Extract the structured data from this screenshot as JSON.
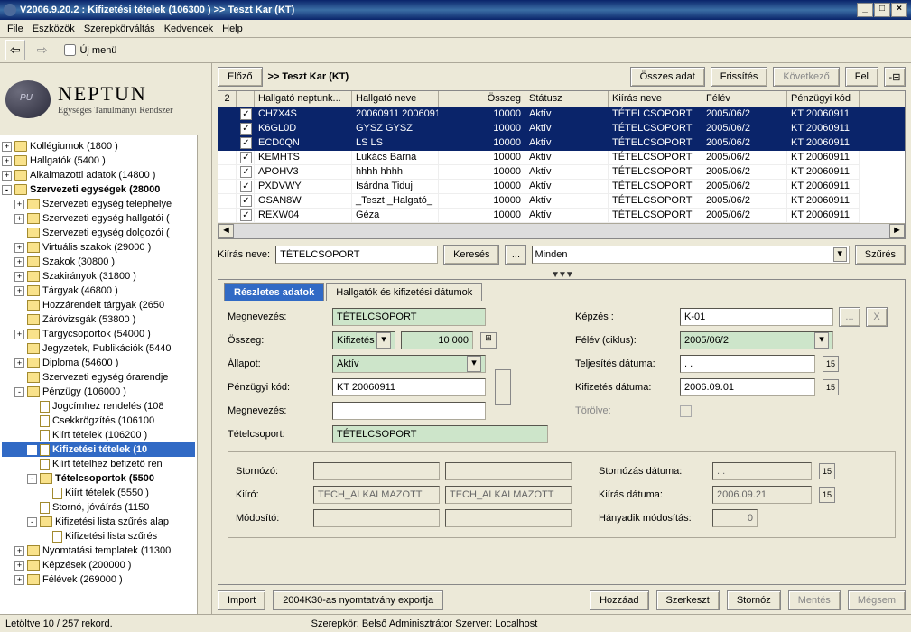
{
  "window": {
    "title": "V2006.9.20.2 : Kifizetési tételek (106300  )  >> Teszt Kar (KT)"
  },
  "menu": {
    "file": "File",
    "tools": "Eszközök",
    "roleswitch": "Szerepkörváltás",
    "fav": "Kedvencek",
    "help": "Help"
  },
  "toolbar": {
    "newmenu": "Új menü"
  },
  "brand": {
    "name": "NEPTUN",
    "sub": "Egységes Tanulmányi Rendszer"
  },
  "tree": [
    {
      "l": 0,
      "exp": "+",
      "ic": "folder-b",
      "t": "Kollégiumok (1800  )"
    },
    {
      "l": 0,
      "exp": "+",
      "ic": "folder-b",
      "t": "Hallgatók (5400  )"
    },
    {
      "l": 0,
      "exp": "+",
      "ic": "folder-b",
      "t": "Alkalmazotti adatok (14800  )"
    },
    {
      "l": 0,
      "exp": "-",
      "ic": "folder-b",
      "t": "Szervezeti egységek (28000",
      "bold": true
    },
    {
      "l": 1,
      "exp": "+",
      "ic": "folder-y",
      "t": "Szervezeti egység telephelye"
    },
    {
      "l": 1,
      "exp": "+",
      "ic": "folder-y",
      "t": "Szervezeti egység hallgatói ("
    },
    {
      "l": 1,
      "exp": " ",
      "ic": "folder-y",
      "t": "Szervezeti egység dolgozói ("
    },
    {
      "l": 1,
      "exp": "+",
      "ic": "folder-y",
      "t": "Virtuális szakok (29000  )"
    },
    {
      "l": 1,
      "exp": "+",
      "ic": "folder-y",
      "t": "Szakok (30800  )"
    },
    {
      "l": 1,
      "exp": "+",
      "ic": "folder-y",
      "t": "Szakirányok (31800  )"
    },
    {
      "l": 1,
      "exp": "+",
      "ic": "folder-y",
      "t": "Tárgyak (46800  )"
    },
    {
      "l": 1,
      "exp": " ",
      "ic": "folder-y",
      "t": "Hozzárendelt tárgyak (2650"
    },
    {
      "l": 1,
      "exp": " ",
      "ic": "folder-y",
      "t": "Záróvizsgák (53800  )",
      "blue": true
    },
    {
      "l": 1,
      "exp": "+",
      "ic": "folder-y",
      "t": "Tárgycsoportok (54000  )"
    },
    {
      "l": 1,
      "exp": " ",
      "ic": "folder-y",
      "t": "Jegyzetek, Publikációk (5440"
    },
    {
      "l": 1,
      "exp": "+",
      "ic": "folder-y",
      "t": "Diploma (54600  )",
      "blue": true
    },
    {
      "l": 1,
      "exp": " ",
      "ic": "folder-y",
      "t": "Szervezeti egység órarendje"
    },
    {
      "l": 1,
      "exp": "-",
      "ic": "folder-y",
      "t": "Pénzügy (106000  )",
      "blue": true
    },
    {
      "l": 2,
      "exp": " ",
      "ic": "page",
      "t": "Jogcímhez rendelés (108"
    },
    {
      "l": 2,
      "exp": " ",
      "ic": "page",
      "t": "Csekkrögzítés (106100"
    },
    {
      "l": 2,
      "exp": " ",
      "ic": "page",
      "t": "Kiírt tételek (106200  )"
    },
    {
      "l": 2,
      "exp": " ",
      "ic": "page",
      "t": "Kifizetési tételek (10",
      "bold": true,
      "sel": true
    },
    {
      "l": 2,
      "exp": " ",
      "ic": "page",
      "t": "Kiírt tételhez befizető ren"
    },
    {
      "l": 2,
      "exp": "-",
      "ic": "folder-y",
      "t": "Tételcsoportok (5500",
      "bold": true
    },
    {
      "l": 3,
      "exp": " ",
      "ic": "page",
      "t": "Kiírt tételek (5550  )"
    },
    {
      "l": 2,
      "exp": " ",
      "ic": "page",
      "t": "Stornó, jóváírás (1150"
    },
    {
      "l": 2,
      "exp": "-",
      "ic": "folder-y",
      "t": "Kifizetési lista szűrés alap"
    },
    {
      "l": 3,
      "exp": " ",
      "ic": "page",
      "t": "Kifizetési lista szűrés"
    },
    {
      "l": 1,
      "exp": "+",
      "ic": "folder-y",
      "t": "Nyomtatási templatek (11300"
    },
    {
      "l": 1,
      "exp": "+",
      "ic": "folder-y",
      "t": "Képzések (200000  )"
    },
    {
      "l": 1,
      "exp": "+",
      "ic": "folder-y",
      "t": "Félévek (269000  )"
    }
  ],
  "header": {
    "prev": "Előző",
    "crumb": ">>  Teszt Kar (KT)",
    "all": "Összes adat",
    "refresh": "Frissítés",
    "next": "Következő",
    "up": "Fel"
  },
  "grid": {
    "corner": "2",
    "columns": [
      "Hallgató neptunk...",
      "Hallgató neve",
      "Összeg",
      "Státusz",
      "Kiírás neve",
      "Félév",
      "Pénzügyi kód"
    ],
    "rows": [
      {
        "sel": true,
        "chk": true,
        "c": [
          "CH7X4S",
          "20060911 2006091",
          "10000",
          "Aktív",
          "TÉTELCSOPORT",
          "2005/06/2",
          "KT 20060911"
        ]
      },
      {
        "sel": true,
        "chk": true,
        "c": [
          "K6GL0D",
          "GYSZ GYSZ",
          "10000",
          "Aktív",
          "TÉTELCSOPORT",
          "2005/06/2",
          "KT 20060911"
        ]
      },
      {
        "sel": true,
        "chk": true,
        "c": [
          "ECD0QN",
          "LS LS",
          "10000",
          "Aktív",
          "TÉTELCSOPORT",
          "2005/06/2",
          "KT 20060911"
        ]
      },
      {
        "sel": false,
        "chk": true,
        "c": [
          "KEMHTS",
          "Lukács Barna",
          "10000",
          "Aktív",
          "TÉTELCSOPORT",
          "2005/06/2",
          "KT 20060911"
        ]
      },
      {
        "sel": false,
        "chk": true,
        "c": [
          "APOHV3",
          "hhhh hhhh",
          "10000",
          "Aktív",
          "TÉTELCSOPORT",
          "2005/06/2",
          "KT 20060911"
        ]
      },
      {
        "sel": false,
        "chk": true,
        "c": [
          "PXDVWY",
          "Isárdna Tiduj",
          "10000",
          "Aktív",
          "TÉTELCSOPORT",
          "2005/06/2",
          "KT 20060911"
        ]
      },
      {
        "sel": false,
        "chk": true,
        "c": [
          "OSAN8W",
          "_Teszt _Halgató_",
          "10000",
          "Aktív",
          "TÉTELCSOPORT",
          "2005/06/2",
          "KT 20060911"
        ]
      },
      {
        "sel": false,
        "chk": true,
        "c": [
          "REXW04",
          "            Géza",
          "10000",
          "Aktív",
          "TÉTELCSOPORT",
          "2005/06/2",
          "KT 20060911"
        ]
      }
    ]
  },
  "filter": {
    "label": "Kiírás neve:",
    "value": "TÉTELCSOPORT",
    "search": "Keresés",
    "dots": "...",
    "all": "Minden",
    "filter": "Szűrés"
  },
  "tabs": {
    "tab1": "Részletes adatok",
    "tab2": "Hallgatók és kifizetési dátumok"
  },
  "form": {
    "megnevezes_lbl": "Megnevezés:",
    "megnevezes": "TÉTELCSOPORT",
    "osszeg_lbl": "Összeg:",
    "osszeg_type": "Kifizetés",
    "osszeg_val": "10 000",
    "allapot_lbl": "Állapot:",
    "allapot": "Aktív",
    "pkod_lbl": "Pénzügyi kód:",
    "pkod": "KT 20060911",
    "megnevezes2_lbl": "Megnevezés:",
    "megnevezes2": "",
    "tetelcsoport_lbl": "Tételcsoport:",
    "tetelcsoport": "TÉTELCSOPORT",
    "kepzes_lbl": "Képzés :",
    "kepzes": "K-01",
    "felev_lbl": "Félév (ciklus):",
    "felev": "2005/06/2",
    "telj_lbl": "Teljesítés dátuma:",
    "telj": ".   .",
    "kifiz_lbl": "Kifizetés dátuma:",
    "kifiz": "2006.09.01",
    "torolve_lbl": "Törölve:",
    "stornozo_lbl": "Stornózó:",
    "stornozo": "",
    "kiiro_lbl": "Kiíró:",
    "kiiro1": "TECH_ALKALMAZOTT",
    "kiiro2": "TECH_ALKALMAZOTT",
    "modosito_lbl": "Módosító:",
    "modosito": "",
    "storno_datum_lbl": "Stornózás dátuma:",
    "storno_datum": ".   .",
    "kiiras_datum_lbl": "Kiírás dátuma:",
    "kiiras_datum": "2006.09.21",
    "hany_lbl": "Hányadik módosítás:",
    "hany": "0"
  },
  "buttons": {
    "import": "Import",
    "export": "2004K30-as nyomtatvány exportja",
    "add": "Hozzáad",
    "edit": "Szerkeszt",
    "storno": "Stornóz",
    "save": "Mentés",
    "cancel": "Mégsem"
  },
  "status": {
    "records": "Letöltve 10 / 257 rekord.",
    "role": "Szerepkör: Belső Adminisztrátor   Szerver: Localhost"
  }
}
